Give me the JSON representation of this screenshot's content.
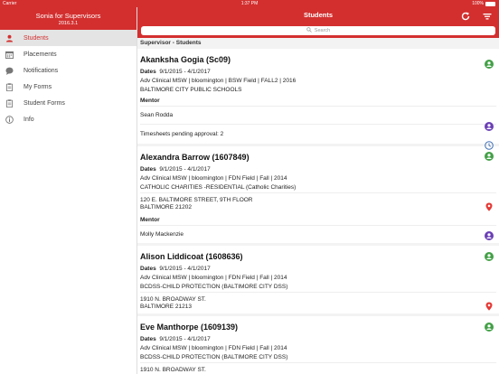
{
  "status_bar": {
    "carrier": "Carrier",
    "time": "1:37 PM",
    "battery": "100%"
  },
  "sidebar": {
    "app_title": "Sonia for Supervisors",
    "version": "2016.3.1",
    "items": [
      {
        "label": "Students",
        "icon": "person-icon",
        "active": true
      },
      {
        "label": "Placements",
        "icon": "calendar-icon",
        "active": false
      },
      {
        "label": "Notifications",
        "icon": "chat-bubble-icon",
        "active": false
      },
      {
        "label": "My Forms",
        "icon": "clipboard-icon",
        "active": false
      },
      {
        "label": "Student Forms",
        "icon": "clipboard-icon",
        "active": false
      },
      {
        "label": "Info",
        "icon": "info-icon",
        "active": false
      }
    ]
  },
  "header": {
    "title": "Students",
    "refresh_icon": "refresh-icon",
    "filter_icon": "filter-icon"
  },
  "search": {
    "placeholder": "Search"
  },
  "section_title": "Supervisor - Students",
  "labels": {
    "dates": "Dates",
    "mentor": "Mentor"
  },
  "students": [
    {
      "name": "Akanksha Gogia (Sc09)",
      "dates": "9/1/2015 - 4/1/2017",
      "program": "Adv Clinical MSW | bloomington | BSW Field | FALL2 | 2016",
      "agency": "BALTIMORE CITY PUBLIC SCHOOLS",
      "mentor": "Sean Rodda",
      "timesheets": "Timesheets pending approval: 2"
    },
    {
      "name": "Alexandra Barrow (1607849)",
      "dates": "9/1/2015 - 4/1/2017",
      "program": "Adv Clinical MSW | bloomington | FDN Field | Fall | 2014",
      "agency": "CATHOLIC CHARITIES -RESIDENTIAL (Catholic Charities)",
      "address1": "120 E. BALTIMORE STREET, 9TH FLOOR",
      "address2": "BALTIMORE 21202",
      "mentor": "Molly Mackenzie"
    },
    {
      "name": "Alison Liddicoat (1608636)",
      "dates": "9/1/2015 - 4/1/2017",
      "program": "Adv Clinical MSW | bloomington | FDN Field | Fall | 2014",
      "agency": "BCDSS-CHILD PROTECTION (BALTIMORE CITY DSS)",
      "address1": "1910 N. BROADWAY ST.",
      "address2": "BALTIMORE 21213"
    },
    {
      "name": "Eve Manthorpe (1609139)",
      "dates": "9/1/2015 - 4/1/2017",
      "program": "Adv Clinical MSW | bloomington | FDN Field | Fall | 2014",
      "agency": "BCDSS-CHILD PROTECTION (BALTIMORE CITY DSS)",
      "address1": "1910 N. BROADWAY ST."
    }
  ],
  "colors": {
    "brand": "#d32f2f",
    "student_icon": "#43a047",
    "mentor_icon": "#6a3fb5",
    "clock_icon": "#3f6fb5",
    "pin_icon": "#e53935"
  }
}
